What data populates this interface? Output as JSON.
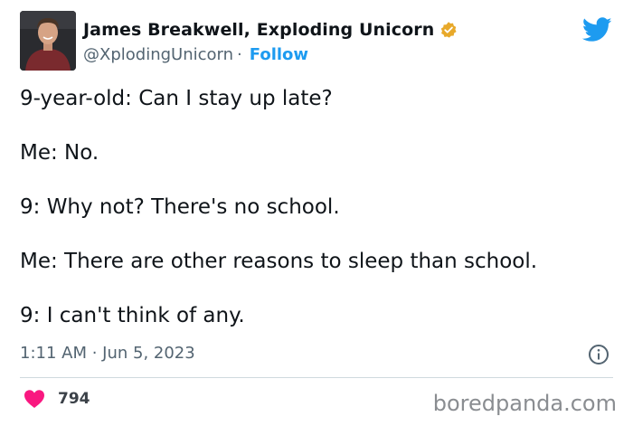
{
  "author": {
    "display_name": "James Breakwell, Exploding Unicorn",
    "handle": "@XplodingUnicorn",
    "separator": "·",
    "follow_label": "Follow",
    "verified_badge_color": "#e8a92a",
    "avatar_icon": "person-avatar"
  },
  "tweet": {
    "lines": [
      "9-year-old: Can I stay up late?",
      "Me: No.",
      "9: Why not? There's no school.",
      "Me: There are other reasons to sleep than school.",
      "9: I can't think of any."
    ],
    "timestamp": "1:11 AM · Jun 5, 2023"
  },
  "engagement": {
    "like_count": "794",
    "heart_color": "#f91880"
  },
  "watermark": "boredpanda.com",
  "colors": {
    "twitter_blue": "#1d9bf0",
    "secondary_text": "#536471"
  }
}
